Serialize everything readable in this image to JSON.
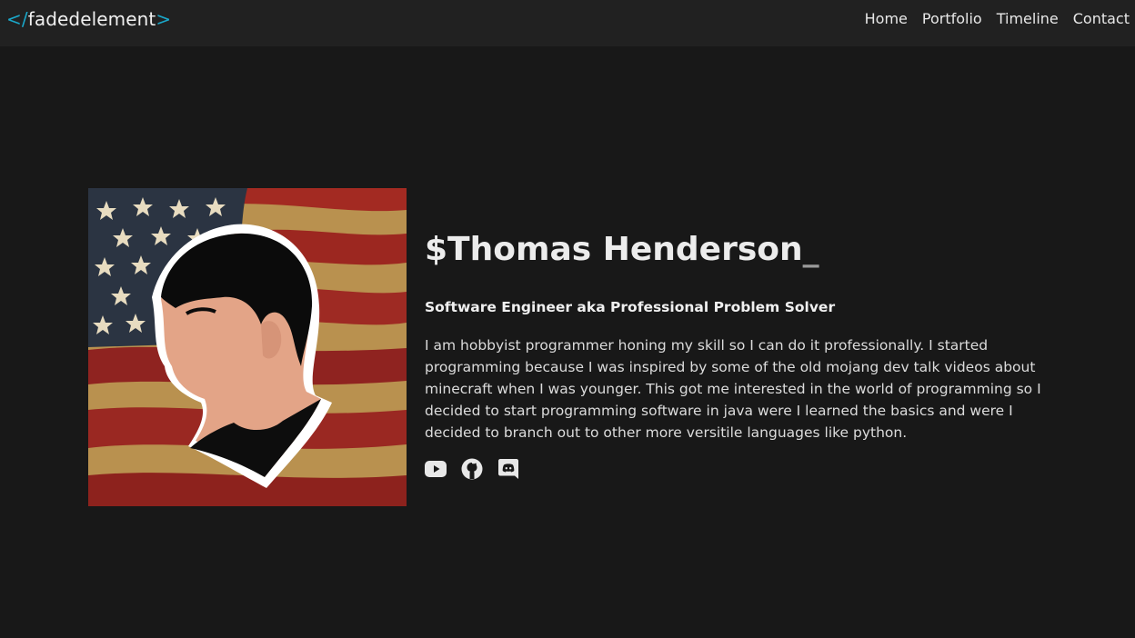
{
  "navbar": {
    "brand": {
      "open": "</",
      "name": "fadedelement",
      "close": ">"
    },
    "links": [
      "Home",
      "Portfolio",
      "Timeline",
      "Contact"
    ]
  },
  "profile": {
    "name": "$Thomas Henderson",
    "cursor": "_",
    "subtitle": "Software Engineer aka Professional Problem Solver",
    "bio": "I am hobbyist programmer honing my skill so I can do it professionally. I started programming because I was inspired by some of the old mojang dev talk videos about minecraft when I was younger. This got me interested in the world of programming so I decided to start programming software in java were I learned the basics and were I decided to branch out to other more versitile languages like python.",
    "avatar": "cartoon-portrait-on-flag"
  },
  "social": {
    "icons": [
      "youtube-icon",
      "github-icon",
      "discord-icon"
    ]
  },
  "colors": {
    "background": "#181818",
    "navbar": "#212121",
    "accent": "#1aa7c9",
    "text": "#e6e6e6"
  }
}
